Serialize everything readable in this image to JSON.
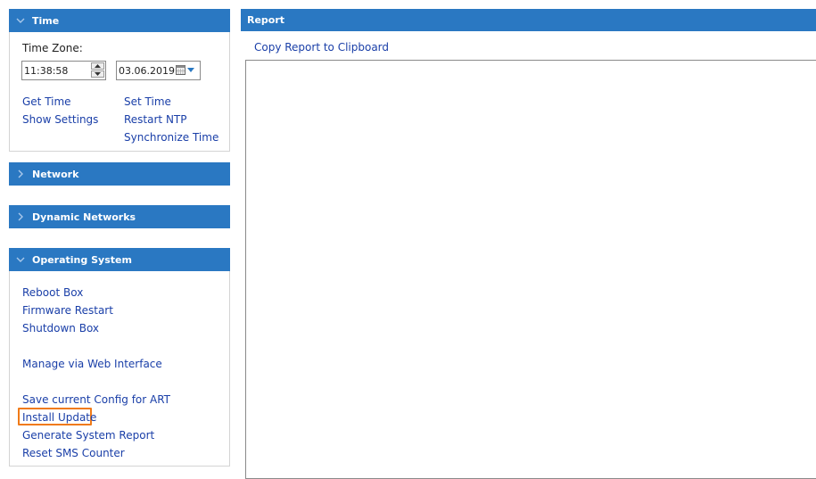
{
  "sidebar": {
    "time": {
      "title": "Time",
      "timezone_label": "Time Zone:",
      "time_value": "11:38:58",
      "date_value": "03.06.2019",
      "links": {
        "get_time": "Get Time",
        "set_time": "Set Time",
        "show_settings": "Show Settings",
        "restart_ntp": "Restart NTP",
        "synchronize_time": "Synchronize Time"
      }
    },
    "network": {
      "title": "Network"
    },
    "dynamic_networks": {
      "title": "Dynamic Networks"
    },
    "operating_system": {
      "title": "Operating System",
      "links": {
        "reboot_box": "Reboot Box",
        "firmware_restart": "Firmware Restart",
        "shutdown_box": "Shutdown Box",
        "manage_web": "Manage via Web Interface",
        "save_config": "Save current Config for ART",
        "install_update": "Install Update",
        "generate_report": "Generate System Report",
        "reset_sms": "Reset SMS Counter"
      }
    }
  },
  "report": {
    "title": "Report",
    "copy_link": "Copy Report to Clipboard"
  },
  "colors": {
    "header_blue": "#2a78c2",
    "link_blue": "#1a3fa8",
    "highlight_orange": "#f07a18"
  }
}
